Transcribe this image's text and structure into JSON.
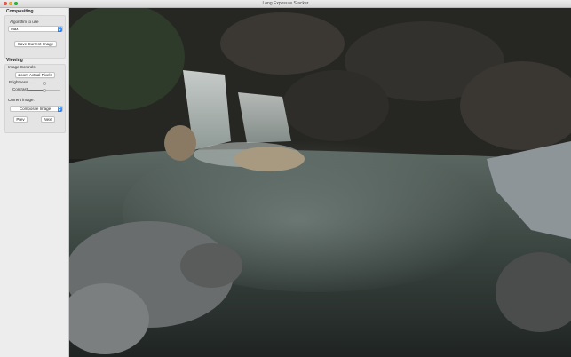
{
  "window": {
    "title": "Long Exposure Stacker"
  },
  "sidebar": {
    "compositing": {
      "title": "Compositing",
      "algorithm_label": "Algorithm to use",
      "algorithm_value": "Max",
      "save_button": "Save Current Image"
    },
    "viewing": {
      "title": "Viewing",
      "image_controls_label": "Image Controls",
      "zoom_button": "Zoom Actual Pixels",
      "brightness_label": "Brightness",
      "brightness_level": 0.5,
      "contrast_label": "Contrast",
      "contrast_level": 0.5,
      "current_image_label": "Current image:",
      "current_image_value": "Composite Image",
      "prev_button": "Prev",
      "next_button": "Next"
    }
  },
  "colors": {
    "accent": "#1e74f5",
    "window_bg": "#ececec"
  },
  "image": {
    "description_icon": "long-exposure-photo"
  }
}
